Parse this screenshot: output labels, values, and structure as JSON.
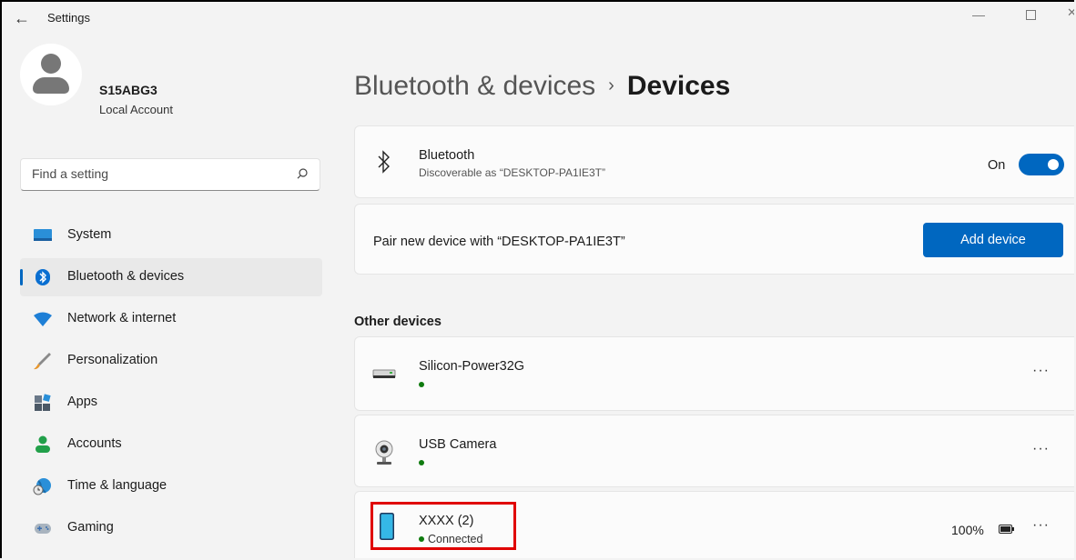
{
  "window": {
    "title": "Settings",
    "controls": {
      "minimize": "—",
      "close": "✕"
    }
  },
  "user": {
    "name": "S15ABG3",
    "account_type": "Local Account"
  },
  "search": {
    "placeholder": "Find a setting"
  },
  "nav": {
    "items": [
      {
        "label": "System",
        "icon": "system-icon"
      },
      {
        "label": "Bluetooth & devices",
        "icon": "bluetooth-icon",
        "active": true
      },
      {
        "label": "Network & internet",
        "icon": "wifi-icon"
      },
      {
        "label": "Personalization",
        "icon": "brush-icon"
      },
      {
        "label": "Apps",
        "icon": "apps-icon"
      },
      {
        "label": "Accounts",
        "icon": "accounts-icon"
      },
      {
        "label": "Time & language",
        "icon": "globe-clock-icon"
      },
      {
        "label": "Gaming",
        "icon": "gamepad-icon"
      }
    ]
  },
  "breadcrumb": {
    "parent": "Bluetooth & devices",
    "separator": "›",
    "current": "Devices"
  },
  "bluetooth": {
    "title": "Bluetooth",
    "subtitle": "Discoverable as “DESKTOP-PA1IE3T”",
    "toggle_label": "On",
    "enabled": true
  },
  "pair": {
    "text": "Pair new device with “DESKTOP-PA1IE3T”",
    "button_label": "Add device"
  },
  "other_devices": {
    "title": "Other devices",
    "devices": [
      {
        "name": "Silicon-Power32G",
        "status": "",
        "icon": "usb-drive-icon",
        "more": "···"
      },
      {
        "name": "USB Camera",
        "status": "",
        "icon": "webcam-icon",
        "more": "···"
      },
      {
        "name": "XXXX (2)",
        "status": "Connected",
        "icon": "phone-icon",
        "battery": "100%",
        "more": "···"
      }
    ]
  },
  "colors": {
    "accent": "#0067c0",
    "status_green": "#0f7b0f",
    "highlight": "#e00000"
  }
}
